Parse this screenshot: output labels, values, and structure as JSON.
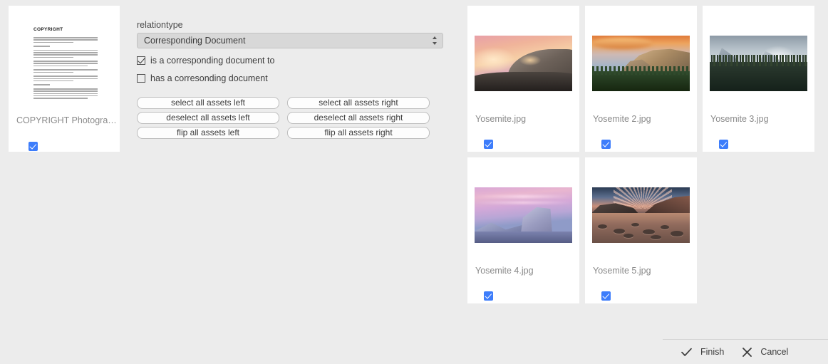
{
  "left_asset": {
    "doc_heading": "COPYRIGHT",
    "label": "COPYRIGHT Photograph...",
    "checkbox_name": "left-asset-checkbox",
    "checked": true
  },
  "form": {
    "relationtype_label": "relationtype",
    "relationtype_value": "Corresponding Document",
    "relationtype_options": [
      "Corresponding Document"
    ],
    "direction_checkboxes": [
      {
        "label": "is a corresponding document to",
        "checked": true
      },
      {
        "label": "has a corresonding document",
        "checked": false
      }
    ],
    "buttons": [
      {
        "label": "select all assets left",
        "name": "select-all-assets-left-button"
      },
      {
        "label": "select all assets right",
        "name": "select-all-assets-right-button"
      },
      {
        "label": "deselect all assets left",
        "name": "deselect-all-assets-left-button"
      },
      {
        "label": "deselect all assets right",
        "name": "deselect-all-assets-right-button"
      },
      {
        "label": "flip all assets left",
        "name": "flip-all-assets-left-button"
      },
      {
        "label": "flip all assets right",
        "name": "flip-all-assets-right-button"
      }
    ]
  },
  "assets": [
    {
      "name": "Yosemite.jpg",
      "checked": true,
      "photo": "half-dome-sunset"
    },
    {
      "name": "Yosemite 2.jpg",
      "checked": true,
      "photo": "el-capitan-sunrise"
    },
    {
      "name": "Yosemite 3.jpg",
      "checked": true,
      "photo": "misty-valley-pines"
    },
    {
      "name": "Yosemite 4.jpg",
      "checked": true,
      "photo": "half-dome-snow-violet"
    },
    {
      "name": "Yosemite 5.jpg",
      "checked": true,
      "photo": "lake-rocks-sunrise"
    }
  ],
  "footer": {
    "finish_label": "Finish",
    "cancel_label": "Cancel"
  },
  "colors": {
    "background": "#ececec",
    "card": "#ffffff",
    "checkbox_accent": "#3d7dfb",
    "text": "#3c3c3c",
    "muted_text": "#8a8a8a",
    "select_bg": "#d8d8d8"
  }
}
